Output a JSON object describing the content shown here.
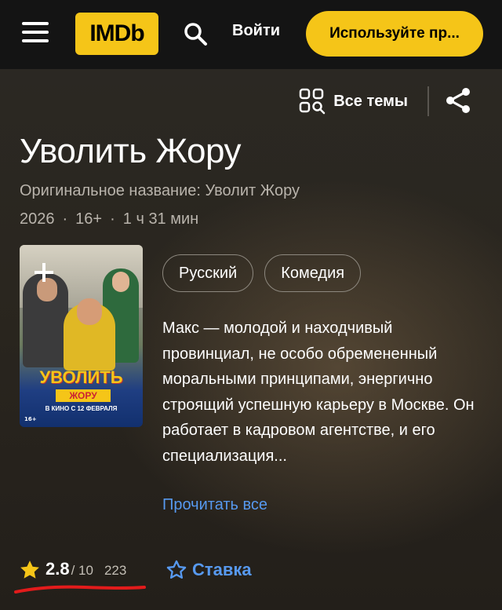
{
  "header": {
    "logo_text": "IMDb",
    "login_label": "Войти",
    "app_button_label": "Используйте пр...",
    "accent_color": "#f5c518"
  },
  "toolbar": {
    "topics_label": "Все темы",
    "topics_icon": "grid-search-icon",
    "share_icon": "share-icon"
  },
  "title": {
    "name": "Уволить Жору",
    "original_title": "Оригинальное название: Уволит Жору",
    "year": "2026",
    "age_rating": "16+",
    "runtime": "1 ч 31 мин",
    "separator": "·"
  },
  "poster": {
    "banner_text": "УВОЛИТЬ",
    "banner_sub": "ЖОРУ",
    "release_text": "В КИНО С 12 ФЕВРАЛЯ",
    "age_badge": "16+",
    "add_icon": "plus-icon"
  },
  "genres": [
    "Русский",
    "Комедия"
  ],
  "plot": {
    "text": "Макс — молодой и находчивый провинциал, не особо обремененный моральными принципами, энергично строящий успешную карьеру в Москве. Он работает в кадровом агентстве, и его специализация...",
    "read_all_label": "Прочитать все",
    "link_color": "#5799ef"
  },
  "rating": {
    "value": "2.8",
    "max": "/ 10",
    "count": "223",
    "rate_label": "Ставка",
    "star_icon": "star-filled-icon",
    "rate_icon": "star-outline-icon"
  }
}
